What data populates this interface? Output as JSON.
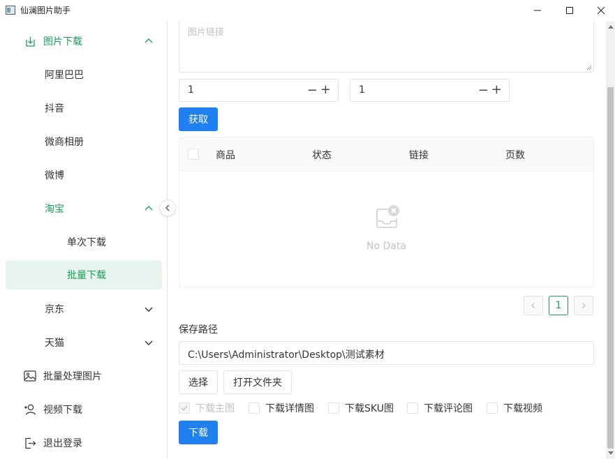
{
  "window": {
    "title": "仙澜图片助手",
    "minimize": "—",
    "maximize": "☐",
    "close": "✕"
  },
  "colors": {
    "accent_green": "#18a058",
    "primary_blue": "#2080f0",
    "selected_bg": "#e7f5ee"
  },
  "sidebar": {
    "items": [
      {
        "label": "图片下载",
        "icon": "download-icon",
        "expanded": true
      },
      {
        "label": "阿里巴巴"
      },
      {
        "label": "抖音"
      },
      {
        "label": "微商相册"
      },
      {
        "label": "微博"
      },
      {
        "label": "淘宝",
        "expanded": true
      },
      {
        "label": "单次下载"
      },
      {
        "label": "批量下载",
        "selected": true
      },
      {
        "label": "京东",
        "expanded": false
      },
      {
        "label": "天猫",
        "expanded": false
      },
      {
        "label": "批量处理图片",
        "icon": "image-icon"
      },
      {
        "label": "视频下载",
        "icon": "user-add-icon"
      },
      {
        "label": "退出登录",
        "icon": "logout-icon"
      }
    ]
  },
  "form": {
    "link_placeholder": "图片链接",
    "start_page": "1",
    "end_page": "1",
    "fetch_button": "获取"
  },
  "table": {
    "columns": [
      "商品",
      "状态",
      "链接",
      "页数"
    ],
    "rows": [],
    "empty_text": "No Data"
  },
  "pagination": {
    "current_page": "1",
    "prev": "‹",
    "next": "›"
  },
  "save": {
    "label": "保存路径",
    "path": "C:\\Users\\Administrator\\Desktop\\测试素材",
    "choose_button": "选择",
    "open_folder_button": "打开文件夹"
  },
  "options": [
    {
      "label": "下载主图",
      "checked": true,
      "disabled": true
    },
    {
      "label": "下载详情图",
      "checked": false
    },
    {
      "label": "下载SKU图",
      "checked": false
    },
    {
      "label": "下载评论图",
      "checked": false
    },
    {
      "label": "下载视频",
      "checked": false
    }
  ],
  "download_button": "下载"
}
